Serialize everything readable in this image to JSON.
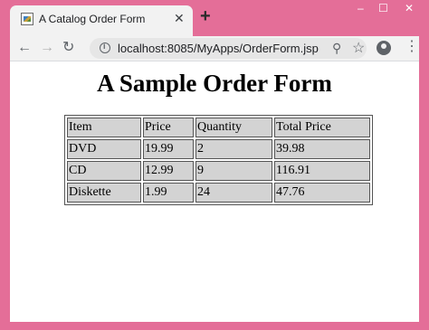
{
  "browser": {
    "tab_title": "A Catalog Order Form",
    "tab_close": "✕",
    "new_tab": "+",
    "url": "localhost:8085/MyApps/OrderForm.jsp",
    "window_controls": {
      "minimize": "–",
      "maximize": "☐",
      "close": "✕"
    },
    "icons": [
      "back-arrow-icon",
      "forward-arrow-icon",
      "reload-icon",
      "info-icon",
      "zoom-icon",
      "star-icon",
      "profile-icon",
      "menu-icon"
    ],
    "frame_color": "#e46e98"
  },
  "page": {
    "heading": "A Sample Order Form",
    "table": {
      "headers": [
        "Item",
        "Price",
        "Quantity",
        "Total Price"
      ],
      "rows": [
        [
          "DVD",
          "19.99",
          "2",
          "39.98"
        ],
        [
          "CD",
          "12.99",
          "9",
          "116.91"
        ],
        [
          "Diskette",
          "1.99",
          "24",
          "47.76"
        ]
      ]
    }
  }
}
